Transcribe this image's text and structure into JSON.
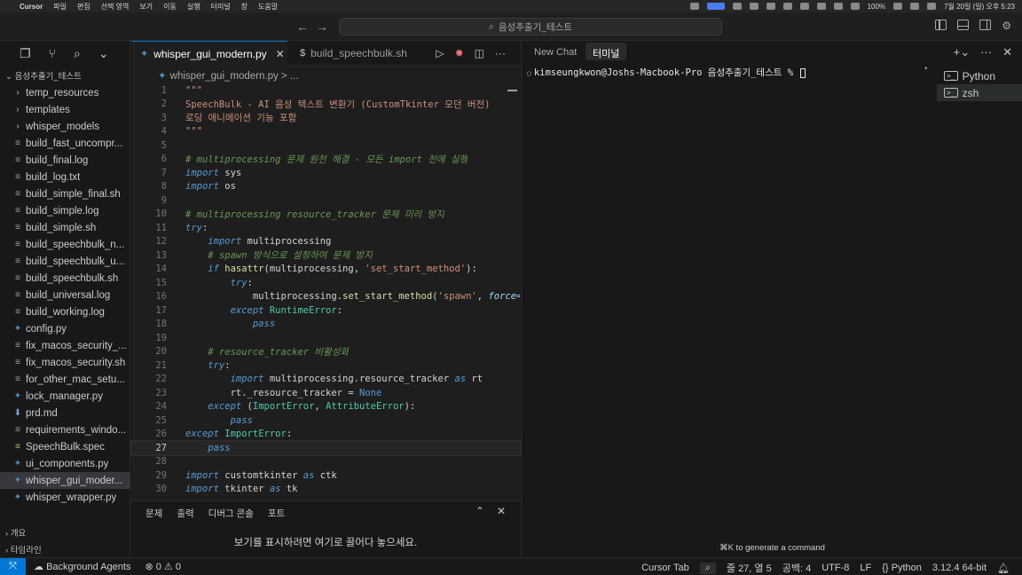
{
  "menubar": {
    "app": "Cursor",
    "items": [
      "파일",
      "편집",
      "선택 영역",
      "보기",
      "이동",
      "실행",
      "터미널",
      "창",
      "도움말"
    ],
    "battery": "100%",
    "clock": "7월 20일 (일) 오후 5:23"
  },
  "titlebar": {
    "search_text": "음성추출기_테스트"
  },
  "explorer": {
    "root": "음성추출기_테스트",
    "files": [
      {
        "name": "temp_resources",
        "icon": "folder"
      },
      {
        "name": "templates",
        "icon": "folder"
      },
      {
        "name": "whisper_models",
        "icon": "folder"
      },
      {
        "name": "build_fast_uncompr...",
        "icon": "file"
      },
      {
        "name": "build_final.log",
        "icon": "file"
      },
      {
        "name": "build_log.txt",
        "icon": "file"
      },
      {
        "name": "build_simple_final.sh",
        "icon": "file"
      },
      {
        "name": "build_simple.log",
        "icon": "file"
      },
      {
        "name": "build_simple.sh",
        "icon": "file"
      },
      {
        "name": "build_speechbulk_n...",
        "icon": "file"
      },
      {
        "name": "build_speechbulk_u...",
        "icon": "file"
      },
      {
        "name": "build_speechbulk.sh",
        "icon": "file"
      },
      {
        "name": "build_universal.log",
        "icon": "file"
      },
      {
        "name": "build_working.log",
        "icon": "file"
      },
      {
        "name": "config.py",
        "icon": "python"
      },
      {
        "name": "fix_macos_security_...",
        "icon": "file"
      },
      {
        "name": "fix_macos_security.sh",
        "icon": "file"
      },
      {
        "name": "for_other_mac_setu...",
        "icon": "file"
      },
      {
        "name": "lock_manager.py",
        "icon": "python"
      },
      {
        "name": "prd.md",
        "icon": "markdown"
      },
      {
        "name": "requirements_windo...",
        "icon": "file"
      },
      {
        "name": "SpeechBulk.spec",
        "icon": "spec"
      },
      {
        "name": "ui_components.py",
        "icon": "python"
      },
      {
        "name": "whisper_gui_moder...",
        "icon": "python",
        "selected": true
      },
      {
        "name": "whisper_wrapper.py",
        "icon": "python"
      }
    ],
    "outline": "개요",
    "timeline": "타임라인"
  },
  "editor": {
    "tabs": [
      {
        "label": "whisper_gui_modern.py",
        "active": true
      },
      {
        "label": "build_speechbulk.sh",
        "active": false
      }
    ],
    "breadcrumb": "whisper_gui_modern.py > ...",
    "current_line": 27,
    "lines": [
      {
        "n": "1",
        "t": "\"\"\""
      },
      {
        "n": "2",
        "t": "SpeechBulk - AI 음성 텍스트 변환기 (CustomTkinter 모던 버전)"
      },
      {
        "n": "3",
        "t": "로딩 애니메이션 기능 포함"
      },
      {
        "n": "4",
        "t": "\"\"\""
      },
      {
        "n": "5",
        "t": ""
      },
      {
        "n": "6",
        "t": "# multiprocessing 문제 원천 해결 - 모든 import 전에 실행"
      },
      {
        "n": "7",
        "t": "import sys"
      },
      {
        "n": "8",
        "t": "import os"
      },
      {
        "n": "9",
        "t": ""
      },
      {
        "n": "10",
        "t": "# multiprocessing resource_tracker 문제 미리 방지"
      },
      {
        "n": "11",
        "t": "try:"
      },
      {
        "n": "12",
        "t": "    import multiprocessing"
      },
      {
        "n": "13",
        "t": "    # spawn 방식으로 설정하여 문제 방지"
      },
      {
        "n": "14",
        "t": "    if hasattr(multiprocessing, 'set_start_method'):"
      },
      {
        "n": "15",
        "t": "        try:"
      },
      {
        "n": "16",
        "t": "            multiprocessing.set_start_method('spawn', force="
      },
      {
        "n": "17",
        "t": "        except RuntimeError:"
      },
      {
        "n": "18",
        "t": "            pass"
      },
      {
        "n": "19",
        "t": ""
      },
      {
        "n": "20",
        "t": "    # resource_tracker 비활성화"
      },
      {
        "n": "21",
        "t": "    try:"
      },
      {
        "n": "22",
        "t": "        import multiprocessing.resource_tracker as rt"
      },
      {
        "n": "23",
        "t": "        rt._resource_tracker = None"
      },
      {
        "n": "24",
        "t": "    except (ImportError, AttributeError):"
      },
      {
        "n": "25",
        "t": "        pass"
      },
      {
        "n": "26",
        "t": "except ImportError:"
      },
      {
        "n": "27",
        "t": "    pass"
      },
      {
        "n": "28",
        "t": ""
      },
      {
        "n": "29",
        "t": "import customtkinter as ctk"
      },
      {
        "n": "30",
        "t": "import tkinter as tk"
      }
    ]
  },
  "panel": {
    "tabs": [
      "문제",
      "출력",
      "디버그 콘솔",
      "포트"
    ],
    "hint": "보기를 표시하려면 여기로 끌어다 놓으세요."
  },
  "right": {
    "tab_chat": "New Chat",
    "tab_terminal": "터미널",
    "prompt": "kimseungkwon@Joshs-Macbook-Pro 음성추출기_테스트 % ",
    "terminals": [
      {
        "label": "Python",
        "selected": false
      },
      {
        "label": "zsh",
        "selected": true
      }
    ],
    "gen_hint": "⌘K to generate a command"
  },
  "statusbar": {
    "agents": "Background Agents",
    "problems": "⊗ 0 ⚠ 0",
    "cursor_tab": "Cursor Tab",
    "position": "줄 27, 열 5",
    "spaces": "공백: 4",
    "encoding": "UTF-8",
    "eol": "LF",
    "language": "Python",
    "interpreter": "3.12.4 64-bit"
  }
}
